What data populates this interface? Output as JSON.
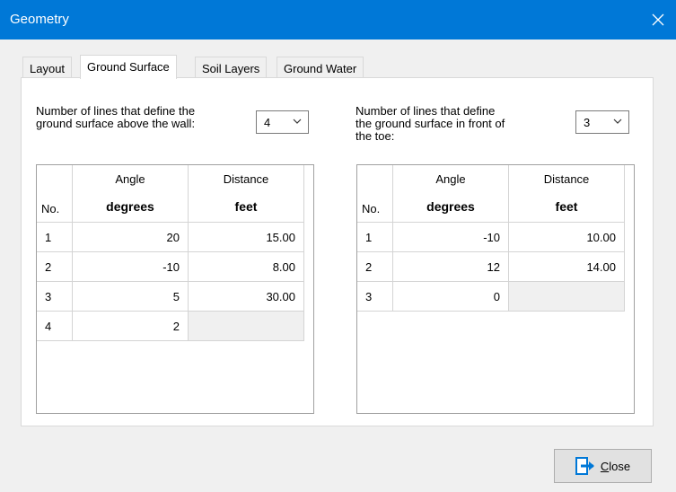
{
  "window": {
    "title": "Geometry"
  },
  "tabs": [
    "Layout",
    "Ground Surface",
    "Soil Layers",
    "Ground Water"
  ],
  "left": {
    "label_line1": "Number of lines that define the",
    "label_line2": "ground surface above the wall:",
    "count": "4",
    "headers": {
      "no": "No.",
      "angle": "Angle",
      "angle_unit": "degrees",
      "distance": "Distance",
      "distance_unit": "feet"
    },
    "rows": [
      {
        "no": "1",
        "angle": "20",
        "distance": "15.00"
      },
      {
        "no": "2",
        "angle": "-10",
        "distance": "8.00"
      },
      {
        "no": "3",
        "angle": "5",
        "distance": "30.00"
      },
      {
        "no": "4",
        "angle": "2",
        "distance": ""
      }
    ]
  },
  "right": {
    "label_line1": "Number of lines that define",
    "label_line2": "the ground surface in front of",
    "label_line3": "the toe:",
    "count": "3",
    "headers": {
      "no": "No.",
      "angle": "Angle",
      "angle_unit": "degrees",
      "distance": "Distance",
      "distance_unit": "feet"
    },
    "rows": [
      {
        "no": "1",
        "angle": "-10",
        "distance": "10.00"
      },
      {
        "no": "2",
        "angle": "12",
        "distance": "14.00"
      },
      {
        "no": "3",
        "angle": "0",
        "distance": ""
      }
    ]
  },
  "buttons": {
    "close_first": "C",
    "close_rest": "lose"
  },
  "icons": {
    "close": "close-icon",
    "dropdown": "chevron-down-icon",
    "exit": "exit-icon"
  },
  "colors": {
    "titlebar": "#0078d7",
    "accent": "#0078d7"
  }
}
